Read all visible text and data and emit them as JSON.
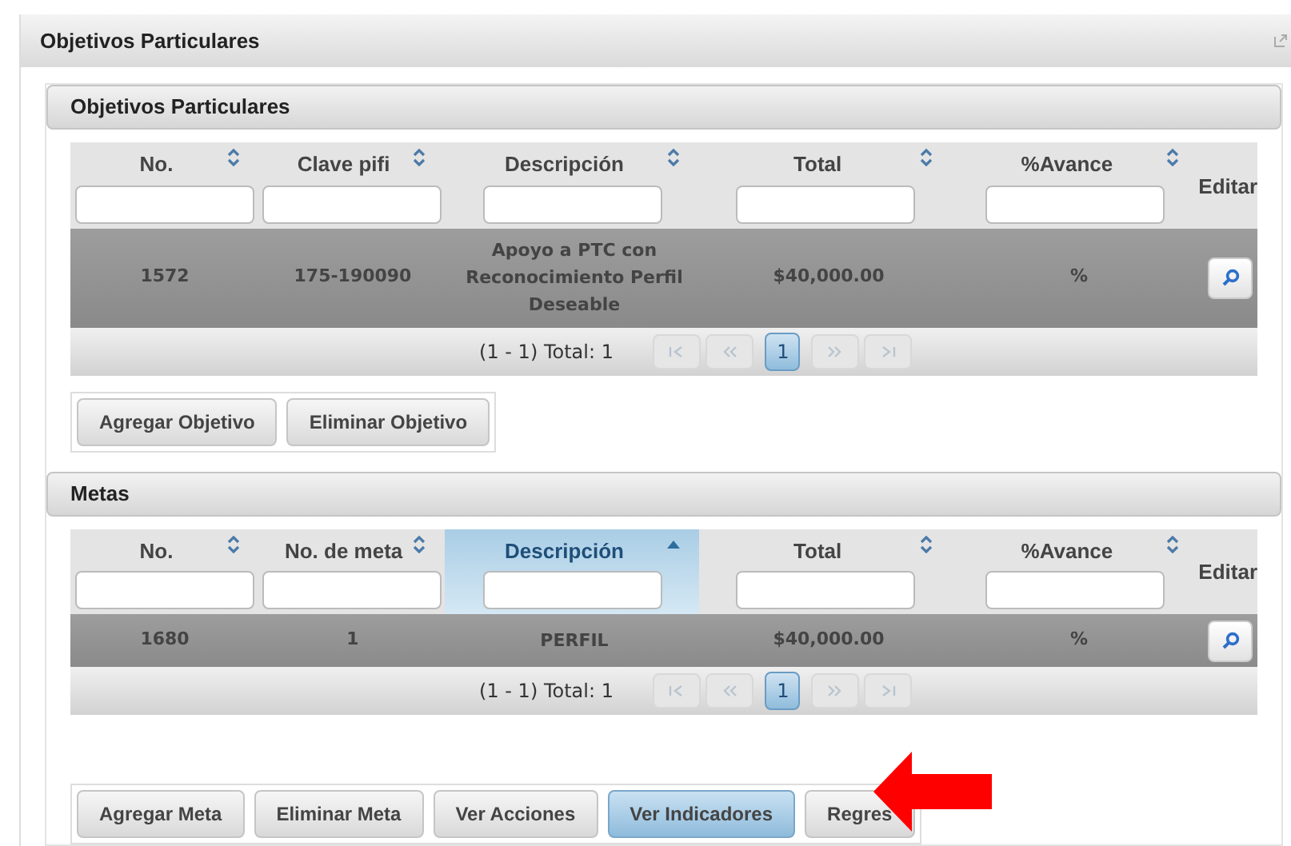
{
  "window": {
    "title": "Objetivos Particulares"
  },
  "sections": [
    {
      "title": "Objetivos Particulares",
      "columns": [
        {
          "label": "No.",
          "sortable": true,
          "sorted": false
        },
        {
          "label": "Clave pifi",
          "sortable": true,
          "sorted": false
        },
        {
          "label": "Descripción",
          "sortable": true,
          "sorted": false
        },
        {
          "label": "Total",
          "sortable": true,
          "sorted": false
        },
        {
          "label": "%Avance",
          "sortable": true,
          "sorted": false
        },
        {
          "label": "Editar",
          "sortable": false,
          "sorted": false
        }
      ],
      "rows": [
        {
          "cells": [
            "1572",
            "175-190090",
            "Apoyo a PTC con Reconocimiento Perfil Deseable",
            "$40,000.00",
            "%"
          ]
        }
      ],
      "paginator": {
        "summary": "(1 - 1) Total: 1",
        "pages": [
          {
            "label": "1",
            "selected": true
          }
        ]
      },
      "buttons": [
        {
          "label": "Agregar Objetivo",
          "selected": false
        },
        {
          "label": "Eliminar Objetivo",
          "selected": false
        }
      ]
    },
    {
      "title": "Metas",
      "columns": [
        {
          "label": "No.",
          "sortable": true,
          "sorted": false
        },
        {
          "label": "No. de meta",
          "sortable": true,
          "sorted": false
        },
        {
          "label": "Descripción",
          "sortable": true,
          "sorted": true
        },
        {
          "label": "Total",
          "sortable": true,
          "sorted": false
        },
        {
          "label": "%Avance",
          "sortable": true,
          "sorted": false
        },
        {
          "label": "Editar",
          "sortable": false,
          "sorted": false
        }
      ],
      "rows": [
        {
          "cells": [
            "1680",
            "1",
            "PERFIL",
            "$40,000.00",
            "%"
          ]
        }
      ],
      "paginator": {
        "summary": "(1 - 1) Total: 1",
        "pages": [
          {
            "label": "1",
            "selected": true
          }
        ]
      },
      "buttons": [
        {
          "label": "Agregar Meta",
          "selected": false
        },
        {
          "label": "Eliminar Meta",
          "selected": false
        },
        {
          "label": "Ver Acciones",
          "selected": false
        },
        {
          "label": "Ver Indicadores",
          "selected": true
        },
        {
          "label": "Regres",
          "selected": false
        }
      ]
    }
  ]
}
